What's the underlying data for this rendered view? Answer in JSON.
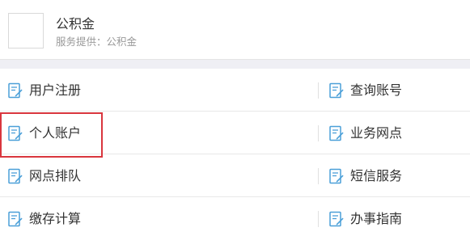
{
  "header": {
    "service_name": "公积金",
    "service_provider": "服务提供：公积金"
  },
  "menu": {
    "icon": "document-edit-icon",
    "icon_color": "#4a9fd8",
    "rows": [
      {
        "left": "用户注册",
        "right": "查询账号"
      },
      {
        "left": "个人账户",
        "right": "业务网点"
      },
      {
        "left": "网点排队",
        "right": "短信服务"
      },
      {
        "left": "缴存计算",
        "right": "办事指南"
      }
    ]
  },
  "highlight": {
    "target": "个人账户",
    "color": "#d9363e"
  }
}
